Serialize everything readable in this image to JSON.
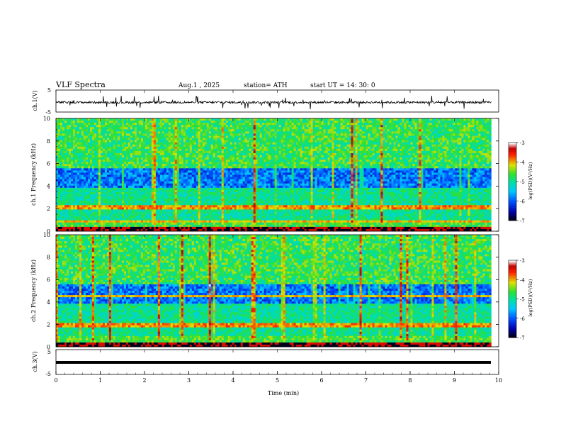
{
  "header": {
    "title": "VLF  Spectra",
    "date": "Aug.1  , 2025",
    "station": "station= ATH",
    "start": "start  UT  =   14: 30: 0"
  },
  "chart_data": [
    {
      "type": "line",
      "name": "ch1-waveform",
      "ylabel": "ch.1(V)",
      "ylim": [
        -5,
        5
      ],
      "yticks": [
        "5",
        "-5"
      ],
      "x_range": [
        0,
        9.83
      ],
      "values_summary": {
        "baseline": -0.6,
        "spike_max": 3,
        "spike_min": -4
      }
    },
    {
      "type": "heatmap",
      "name": "ch1-spectrogram",
      "ylabel": "ch.1\nFrequency  (kHz)",
      "ylim": [
        0,
        10
      ],
      "yticks": [
        "0",
        "2",
        "4",
        "6",
        "8",
        "10"
      ],
      "x_range": [
        0,
        9.83
      ],
      "colorbar": {
        "label": "log(PSD)(V²/Hz)",
        "ticks": [
          "-3",
          "-4",
          "-5",
          "-6",
          "-7"
        ],
        "range": [
          -7,
          -3
        ]
      }
    },
    {
      "type": "heatmap",
      "name": "ch2-spectrogram",
      "ylabel": "ch.2\nFrequency  (kHz)",
      "ylim": [
        0,
        10
      ],
      "yticks": [
        "0",
        "2",
        "4",
        "6",
        "8",
        "10"
      ],
      "x_range": [
        0,
        9.83
      ],
      "colorbar": {
        "label": "log(PSD)(V²/Hz)",
        "ticks": [
          "-3",
          "-4",
          "-5",
          "-6",
          "-7"
        ],
        "range": [
          -7,
          -3
        ]
      }
    },
    {
      "type": "line",
      "name": "ch3-waveform",
      "ylabel": "ch.3(V)",
      "ylim": [
        -5,
        5
      ],
      "yticks": [
        "5",
        "-5"
      ],
      "x_range": [
        0,
        9.83
      ],
      "values_summary": {
        "baseline": -1.6
      }
    }
  ],
  "xaxis": {
    "label": "Time  (min)",
    "range": [
      0,
      10
    ],
    "ticks": [
      "0",
      "1",
      "2",
      "3",
      "4",
      "5",
      "6",
      "7",
      "8",
      "9",
      "10"
    ]
  }
}
